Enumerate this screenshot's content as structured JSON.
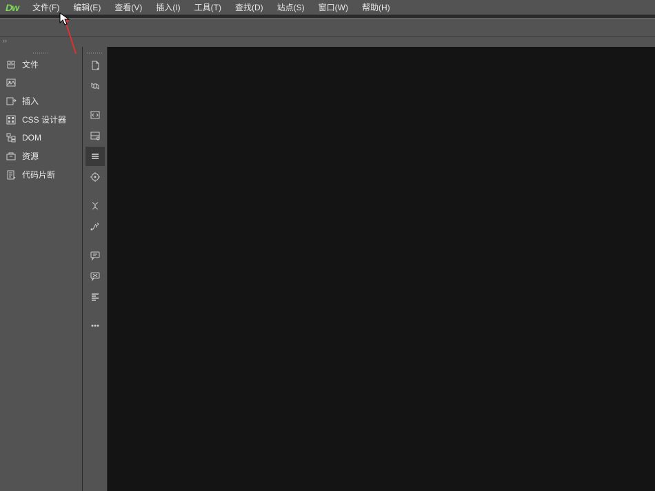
{
  "app": {
    "logo": "Dw"
  },
  "menu": {
    "file": "文件(F)",
    "edit": "编辑(E)",
    "view": "查看(V)",
    "insert": "插入(I)",
    "tools": "工具(T)",
    "find": "查找(D)",
    "site": "站点(S)",
    "window": "窗口(W)",
    "help": "帮助(H)"
  },
  "panel_toggle": "››",
  "panels": {
    "files": "文件",
    "insert": "插入",
    "css_designer": "CSS 设计器",
    "dom": "DOM",
    "assets": "资源",
    "snippets": "代码片断"
  }
}
